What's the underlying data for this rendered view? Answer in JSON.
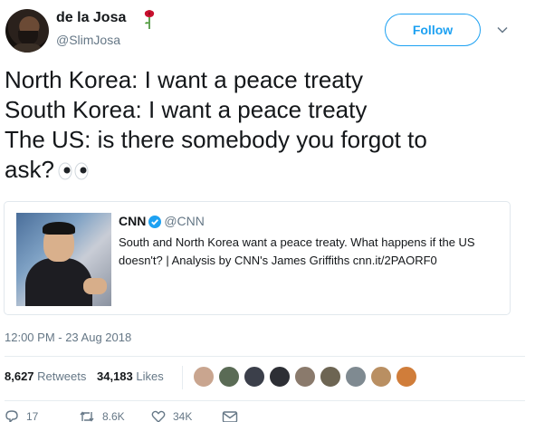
{
  "user": {
    "display_name": "de la Josa",
    "handle": "@SlimJosa",
    "avatar_icon": "user-avatar",
    "name_emoji_icon": "rose-icon"
  },
  "follow_button": {
    "label": "Follow"
  },
  "menu_icon": "chevron-down-icon",
  "tweet": {
    "lines": [
      "North Korea: I want a peace treaty",
      "South Korea: I want a peace treaty",
      "The US: is there somebody you forgot to",
      "ask?"
    ],
    "emoji_icon": "eyes-icon"
  },
  "quoted": {
    "name": "CNN",
    "handle": "@CNN",
    "text": "South and North Korea want a peace treaty. What happens if the US doesn't? | Analysis by CNN's James Griffiths cnn.it/2PAORF0",
    "image_icon": "photo-thumbnail",
    "verified_icon": "verified-badge-icon"
  },
  "timestamp": "12:00 PM - 23 Aug 2018",
  "stats": {
    "retweets_count": "8,627",
    "retweets_label": "Retweets",
    "likes_count": "34,183",
    "likes_label": "Likes"
  },
  "likers": [
    {
      "color": "#c9a58f"
    },
    {
      "color": "#5a6b55"
    },
    {
      "color": "#3b3f4a"
    },
    {
      "color": "#2d2f35"
    },
    {
      "color": "#8a7a6c"
    },
    {
      "color": "#6d6553"
    },
    {
      "color": "#7f8a91"
    },
    {
      "color": "#b98f62"
    },
    {
      "color": "#d07d3a"
    }
  ],
  "actions": {
    "reply_count": "17",
    "retweet_count": "8.6K",
    "like_count": "34K"
  },
  "colors": {
    "accent": "#1da1f2",
    "text": "#14171a",
    "secondary": "#657786",
    "border": "#e1e8ed"
  }
}
